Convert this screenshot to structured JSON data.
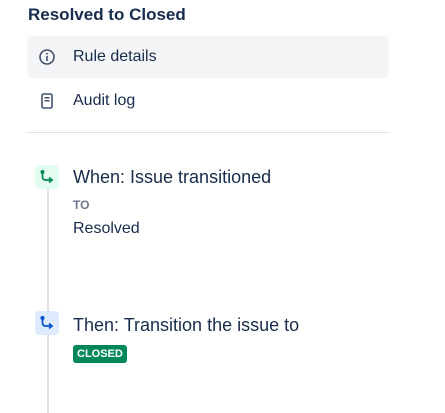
{
  "rule": {
    "title": "Resolved to Closed"
  },
  "nav": {
    "items": [
      {
        "label": "Rule details",
        "icon": "info-icon",
        "active": true
      },
      {
        "label": "Audit log",
        "icon": "document-icon",
        "active": false
      }
    ]
  },
  "steps": [
    {
      "type": "trigger",
      "icon": "branch-arrow-icon",
      "color": "#00875a",
      "title": "When: Issue transitioned",
      "sublabel": "TO",
      "value": "Resolved"
    },
    {
      "type": "action",
      "icon": "branch-arrow-icon",
      "color": "#0052cc",
      "title": "Then: Transition the issue to",
      "status": "CLOSED"
    }
  ],
  "colors": {
    "status_closed": "#00875a",
    "nav_active_bg": "#f4f5f7"
  }
}
